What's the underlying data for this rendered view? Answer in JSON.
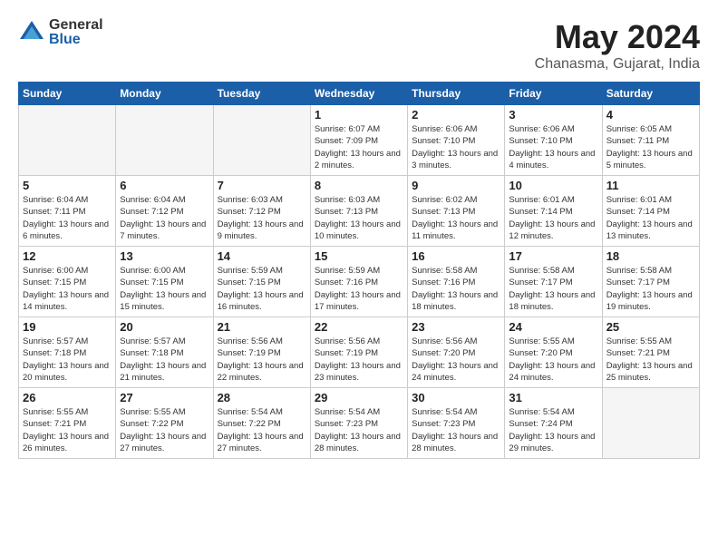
{
  "logo": {
    "general": "General",
    "blue": "Blue"
  },
  "title": "May 2024",
  "subtitle": "Chanasma, Gujarat, India",
  "days_of_week": [
    "Sunday",
    "Monday",
    "Tuesday",
    "Wednesday",
    "Thursday",
    "Friday",
    "Saturday"
  ],
  "weeks": [
    [
      {
        "day": "",
        "info": ""
      },
      {
        "day": "",
        "info": ""
      },
      {
        "day": "",
        "info": ""
      },
      {
        "day": "1",
        "info": "Sunrise: 6:07 AM\nSunset: 7:09 PM\nDaylight: 13 hours\nand 2 minutes."
      },
      {
        "day": "2",
        "info": "Sunrise: 6:06 AM\nSunset: 7:10 PM\nDaylight: 13 hours\nand 3 minutes."
      },
      {
        "day": "3",
        "info": "Sunrise: 6:06 AM\nSunset: 7:10 PM\nDaylight: 13 hours\nand 4 minutes."
      },
      {
        "day": "4",
        "info": "Sunrise: 6:05 AM\nSunset: 7:11 PM\nDaylight: 13 hours\nand 5 minutes."
      }
    ],
    [
      {
        "day": "5",
        "info": "Sunrise: 6:04 AM\nSunset: 7:11 PM\nDaylight: 13 hours\nand 6 minutes."
      },
      {
        "day": "6",
        "info": "Sunrise: 6:04 AM\nSunset: 7:12 PM\nDaylight: 13 hours\nand 7 minutes."
      },
      {
        "day": "7",
        "info": "Sunrise: 6:03 AM\nSunset: 7:12 PM\nDaylight: 13 hours\nand 9 minutes."
      },
      {
        "day": "8",
        "info": "Sunrise: 6:03 AM\nSunset: 7:13 PM\nDaylight: 13 hours\nand 10 minutes."
      },
      {
        "day": "9",
        "info": "Sunrise: 6:02 AM\nSunset: 7:13 PM\nDaylight: 13 hours\nand 11 minutes."
      },
      {
        "day": "10",
        "info": "Sunrise: 6:01 AM\nSunset: 7:14 PM\nDaylight: 13 hours\nand 12 minutes."
      },
      {
        "day": "11",
        "info": "Sunrise: 6:01 AM\nSunset: 7:14 PM\nDaylight: 13 hours\nand 13 minutes."
      }
    ],
    [
      {
        "day": "12",
        "info": "Sunrise: 6:00 AM\nSunset: 7:15 PM\nDaylight: 13 hours\nand 14 minutes."
      },
      {
        "day": "13",
        "info": "Sunrise: 6:00 AM\nSunset: 7:15 PM\nDaylight: 13 hours\nand 15 minutes."
      },
      {
        "day": "14",
        "info": "Sunrise: 5:59 AM\nSunset: 7:15 PM\nDaylight: 13 hours\nand 16 minutes."
      },
      {
        "day": "15",
        "info": "Sunrise: 5:59 AM\nSunset: 7:16 PM\nDaylight: 13 hours\nand 17 minutes."
      },
      {
        "day": "16",
        "info": "Sunrise: 5:58 AM\nSunset: 7:16 PM\nDaylight: 13 hours\nand 18 minutes."
      },
      {
        "day": "17",
        "info": "Sunrise: 5:58 AM\nSunset: 7:17 PM\nDaylight: 13 hours\nand 18 minutes."
      },
      {
        "day": "18",
        "info": "Sunrise: 5:58 AM\nSunset: 7:17 PM\nDaylight: 13 hours\nand 19 minutes."
      }
    ],
    [
      {
        "day": "19",
        "info": "Sunrise: 5:57 AM\nSunset: 7:18 PM\nDaylight: 13 hours\nand 20 minutes."
      },
      {
        "day": "20",
        "info": "Sunrise: 5:57 AM\nSunset: 7:18 PM\nDaylight: 13 hours\nand 21 minutes."
      },
      {
        "day": "21",
        "info": "Sunrise: 5:56 AM\nSunset: 7:19 PM\nDaylight: 13 hours\nand 22 minutes."
      },
      {
        "day": "22",
        "info": "Sunrise: 5:56 AM\nSunset: 7:19 PM\nDaylight: 13 hours\nand 23 minutes."
      },
      {
        "day": "23",
        "info": "Sunrise: 5:56 AM\nSunset: 7:20 PM\nDaylight: 13 hours\nand 24 minutes."
      },
      {
        "day": "24",
        "info": "Sunrise: 5:55 AM\nSunset: 7:20 PM\nDaylight: 13 hours\nand 24 minutes."
      },
      {
        "day": "25",
        "info": "Sunrise: 5:55 AM\nSunset: 7:21 PM\nDaylight: 13 hours\nand 25 minutes."
      }
    ],
    [
      {
        "day": "26",
        "info": "Sunrise: 5:55 AM\nSunset: 7:21 PM\nDaylight: 13 hours\nand 26 minutes."
      },
      {
        "day": "27",
        "info": "Sunrise: 5:55 AM\nSunset: 7:22 PM\nDaylight: 13 hours\nand 27 minutes."
      },
      {
        "day": "28",
        "info": "Sunrise: 5:54 AM\nSunset: 7:22 PM\nDaylight: 13 hours\nand 27 minutes."
      },
      {
        "day": "29",
        "info": "Sunrise: 5:54 AM\nSunset: 7:23 PM\nDaylight: 13 hours\nand 28 minutes."
      },
      {
        "day": "30",
        "info": "Sunrise: 5:54 AM\nSunset: 7:23 PM\nDaylight: 13 hours\nand 28 minutes."
      },
      {
        "day": "31",
        "info": "Sunrise: 5:54 AM\nSunset: 7:24 PM\nDaylight: 13 hours\nand 29 minutes."
      },
      {
        "day": "",
        "info": ""
      }
    ]
  ]
}
